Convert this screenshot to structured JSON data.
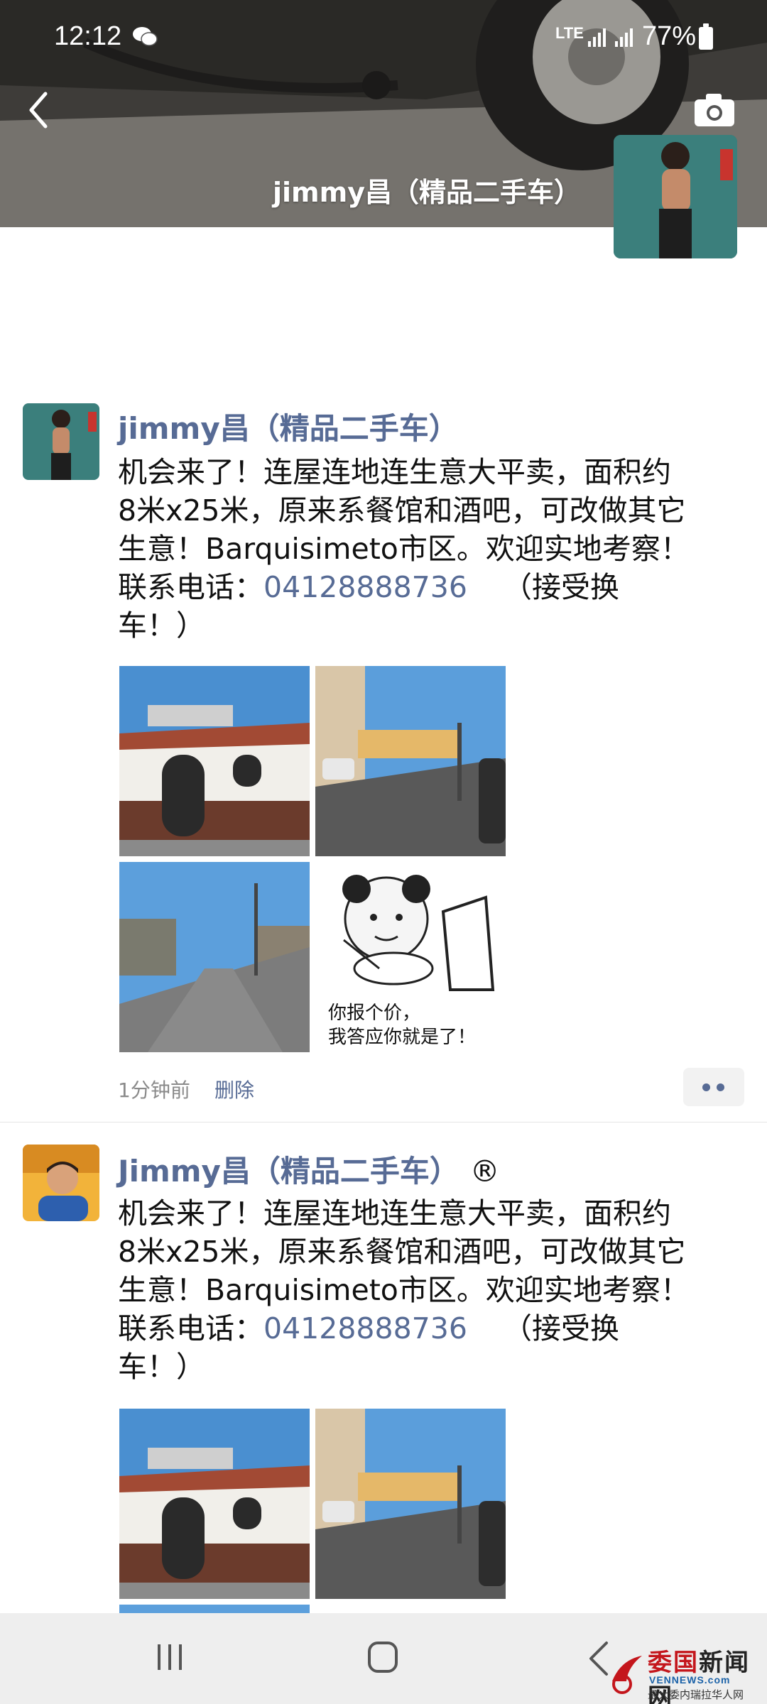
{
  "status_bar": {
    "time": "12:12",
    "network": "LTE",
    "battery": "77%",
    "icons": [
      "wechat-icon",
      "signal-icon",
      "battery-icon"
    ]
  },
  "cover": {
    "name": "jimmy昌（精品二手车）",
    "icons": [
      "back-arrow-icon",
      "camera-icon"
    ]
  },
  "posts": [
    {
      "author": "jimmy昌（精品二手车）",
      "text_lines": [
        "机会来了！连屋连地连生意大平卖，面积约",
        "8米x25米，原来系餐馆和酒吧，可改做其它",
        "生意！Barquisimeto市区。欢迎实地考察！",
        "联系电话：",
        "车！）"
      ],
      "phone": "04128888736",
      "phone_suffix": "（接受换",
      "meme_caption_1": "你报个价，",
      "meme_caption_2": "我答应你就是了！",
      "time": "1分钟前",
      "delete_label": "删除"
    },
    {
      "author": "Jimmy昌（精品二手车）",
      "badge": "®",
      "text_lines": [
        "机会来了！连屋连地连生意大平卖，面积约",
        "8米x25米，原来系餐馆和酒吧，可改做其它",
        "生意！Barquisimeto市区。欢迎实地考察！",
        "联系电话：",
        "车！）"
      ],
      "phone": "04128888736",
      "phone_suffix": "（接受换"
    }
  ],
  "watermark": {
    "title_red": "委国",
    "title_dark": "新闻网",
    "url": "VENNEWS.com",
    "subtitle": "最大委内瑞拉华人网"
  },
  "colors": {
    "link": "#576b95",
    "meta": "#8a8a8a",
    "navbar": "#eeeeee"
  }
}
